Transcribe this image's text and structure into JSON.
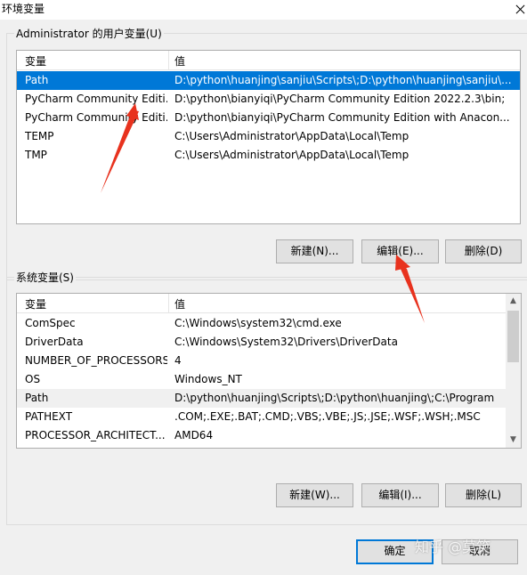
{
  "window": {
    "title": "环境变量"
  },
  "user_vars": {
    "group_label": "Administrator 的用户变量(U)",
    "columns": [
      "变量",
      "值"
    ],
    "rows": [
      {
        "name": "Path",
        "value": "D:\\python\\huanjing\\sanjiu\\Scripts\\;D:\\python\\huanjing\\sanjiu\\..."
      },
      {
        "name": "PyCharm Community Editi...",
        "value": "D:\\python\\bianyiqi\\PyCharm Community Edition 2022.2.3\\bin;"
      },
      {
        "name": "PyCharm Community Editi...",
        "value": "D:\\python\\bianyiqi\\PyCharm Community Edition with Anacon..."
      },
      {
        "name": "TEMP",
        "value": "C:\\Users\\Administrator\\AppData\\Local\\Temp"
      },
      {
        "name": "TMP",
        "value": "C:\\Users\\Administrator\\AppData\\Local\\Temp"
      }
    ],
    "selected_index": 0,
    "buttons": {
      "new": "新建(N)...",
      "edit": "编辑(E)...",
      "delete": "删除(D)"
    }
  },
  "system_vars": {
    "group_label": "系统变量(S)",
    "columns": [
      "变量",
      "值"
    ],
    "rows": [
      {
        "name": "ComSpec",
        "value": "C:\\Windows\\system32\\cmd.exe"
      },
      {
        "name": "DriverData",
        "value": "C:\\Windows\\System32\\Drivers\\DriverData"
      },
      {
        "name": "NUMBER_OF_PROCESSORS",
        "value": "4"
      },
      {
        "name": "OS",
        "value": "Windows_NT"
      },
      {
        "name": "Path",
        "value": "D:\\python\\huanjing\\Scripts\\;D:\\python\\huanjing\\;C:\\Program ..."
      },
      {
        "name": "PATHEXT",
        "value": ".COM;.EXE;.BAT;.CMD;.VBS;.VBE;.JS;.JSE;.WSF;.WSH;.MSC"
      },
      {
        "name": "PROCESSOR_ARCHITECT...",
        "value": "AMD64"
      }
    ],
    "hover_index": 4,
    "buttons": {
      "new": "新建(W)...",
      "edit": "编辑(I)...",
      "delete": "删除(L)"
    }
  },
  "footer": {
    "ok": "确定",
    "cancel": "取消"
  },
  "watermark": "知乎 @莫笑",
  "colors": {
    "selection": "#0078d7",
    "annotation_arrow": "#e8321e"
  }
}
